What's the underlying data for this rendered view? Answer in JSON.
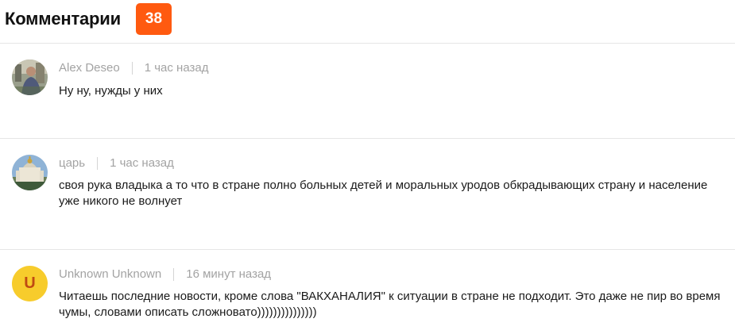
{
  "header": {
    "title": "Комментарии",
    "count": "38"
  },
  "colors": {
    "accent": "#ff5a10",
    "meta_text": "#a3a3a3",
    "avatar_letter_bg": "#f7cc2c"
  },
  "comments": [
    {
      "author": "Alex Deseo",
      "time": "1 час назад",
      "text": "Ну ну, нужды у них",
      "avatar": "photo-avatar-person"
    },
    {
      "author": "царь",
      "time": "1 час назад",
      "text": "своя рука владыка а то что в стране полно больных детей и моральных уродов обкрадывающих страну и население уже никого не волнует",
      "avatar": "photo-avatar-church"
    },
    {
      "author": "Unknown Unknown",
      "time": "16 минут назад",
      "text": "Читаешь последние новости, кроме слова \"ВАКХАНАЛИЯ\" к ситуации в стране не подходит. Это даже не пир во время чумы, словами описать сложновато)))))))))))))))",
      "avatar_letter": "U"
    }
  ]
}
